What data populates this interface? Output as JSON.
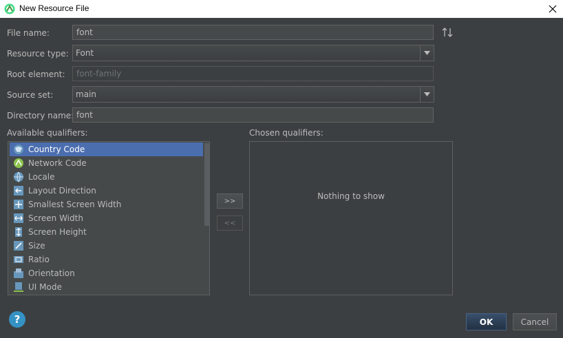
{
  "window": {
    "title": "New Resource File"
  },
  "form": {
    "file_name_label": "File name:",
    "file_name_value": "font",
    "resource_type_label": "Resource type:",
    "resource_type_value": "Font",
    "root_element_label": "Root element:",
    "root_element_value": "font-family",
    "source_set_label": "Source set:",
    "source_set_value": "main",
    "directory_name_label": "Directory name:",
    "directory_name_value": "font"
  },
  "qualifiers": {
    "available_label": "Available qualifiers:",
    "chosen_label": "Chosen qualifiers:",
    "available_items": [
      {
        "label": "Country Code",
        "icon": "country-code-icon"
      },
      {
        "label": "Network Code",
        "icon": "network-code-icon"
      },
      {
        "label": "Locale",
        "icon": "locale-icon"
      },
      {
        "label": "Layout Direction",
        "icon": "layout-direction-icon"
      },
      {
        "label": "Smallest Screen Width",
        "icon": "smallest-screen-width-icon"
      },
      {
        "label": "Screen Width",
        "icon": "screen-width-icon"
      },
      {
        "label": "Screen Height",
        "icon": "screen-height-icon"
      },
      {
        "label": "Size",
        "icon": "size-icon"
      },
      {
        "label": "Ratio",
        "icon": "ratio-icon"
      },
      {
        "label": "Orientation",
        "icon": "orientation-icon"
      },
      {
        "label": "UI Mode",
        "icon": "ui-mode-icon"
      }
    ],
    "selected_index": 0,
    "add_button_label": ">>",
    "remove_button_label": "<<",
    "empty_text": "Nothing to show"
  },
  "footer": {
    "help_label": "?",
    "ok_label": "OK",
    "cancel_label": "Cancel"
  },
  "colors": {
    "background": "#3c3f41",
    "selection": "#4b6eaf",
    "help": "#3592c4"
  }
}
